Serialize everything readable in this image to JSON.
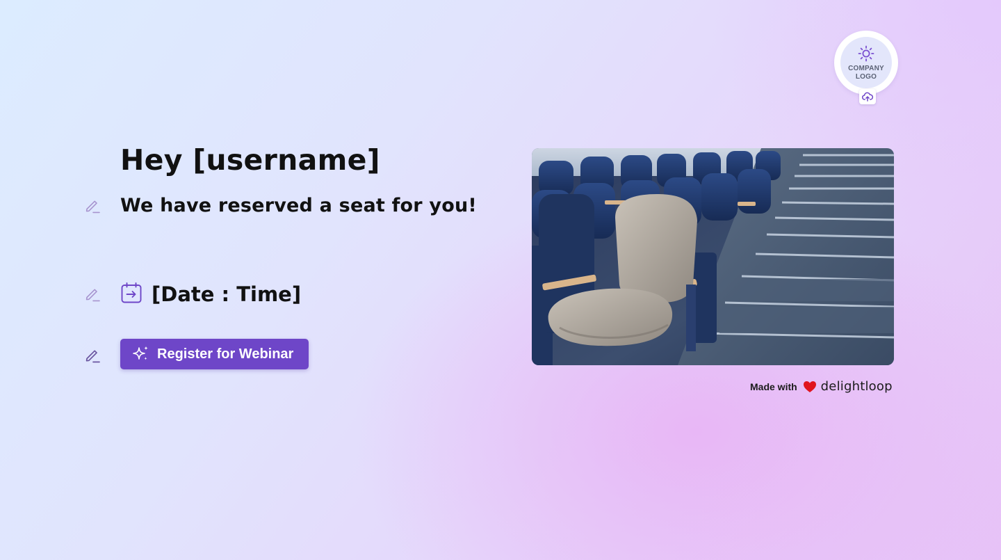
{
  "logo": {
    "placeholder_text": "COMPANY LOGO",
    "icon": "sun-icon",
    "upload_icon": "cloud-upload-icon"
  },
  "content": {
    "greeting": "Hey [username]",
    "subheading": "We have reserved a seat for you!",
    "datetime": "[Date : Time]",
    "datetime_icon": "calendar-arrow-icon",
    "edit_icon": "pencil-edit-icon"
  },
  "cta": {
    "label": "Register for Webinar",
    "icon": "sparkles-icon"
  },
  "image": {
    "subject": "auditorium-seat-photo"
  },
  "footer": {
    "made_with": "Made with",
    "heart_icon": "heart-icon",
    "brand": "delightloop"
  },
  "colors": {
    "accent": "#6e46c8",
    "heart": "#e0141e",
    "text": "#111111",
    "pencil": "#9b86c6"
  }
}
